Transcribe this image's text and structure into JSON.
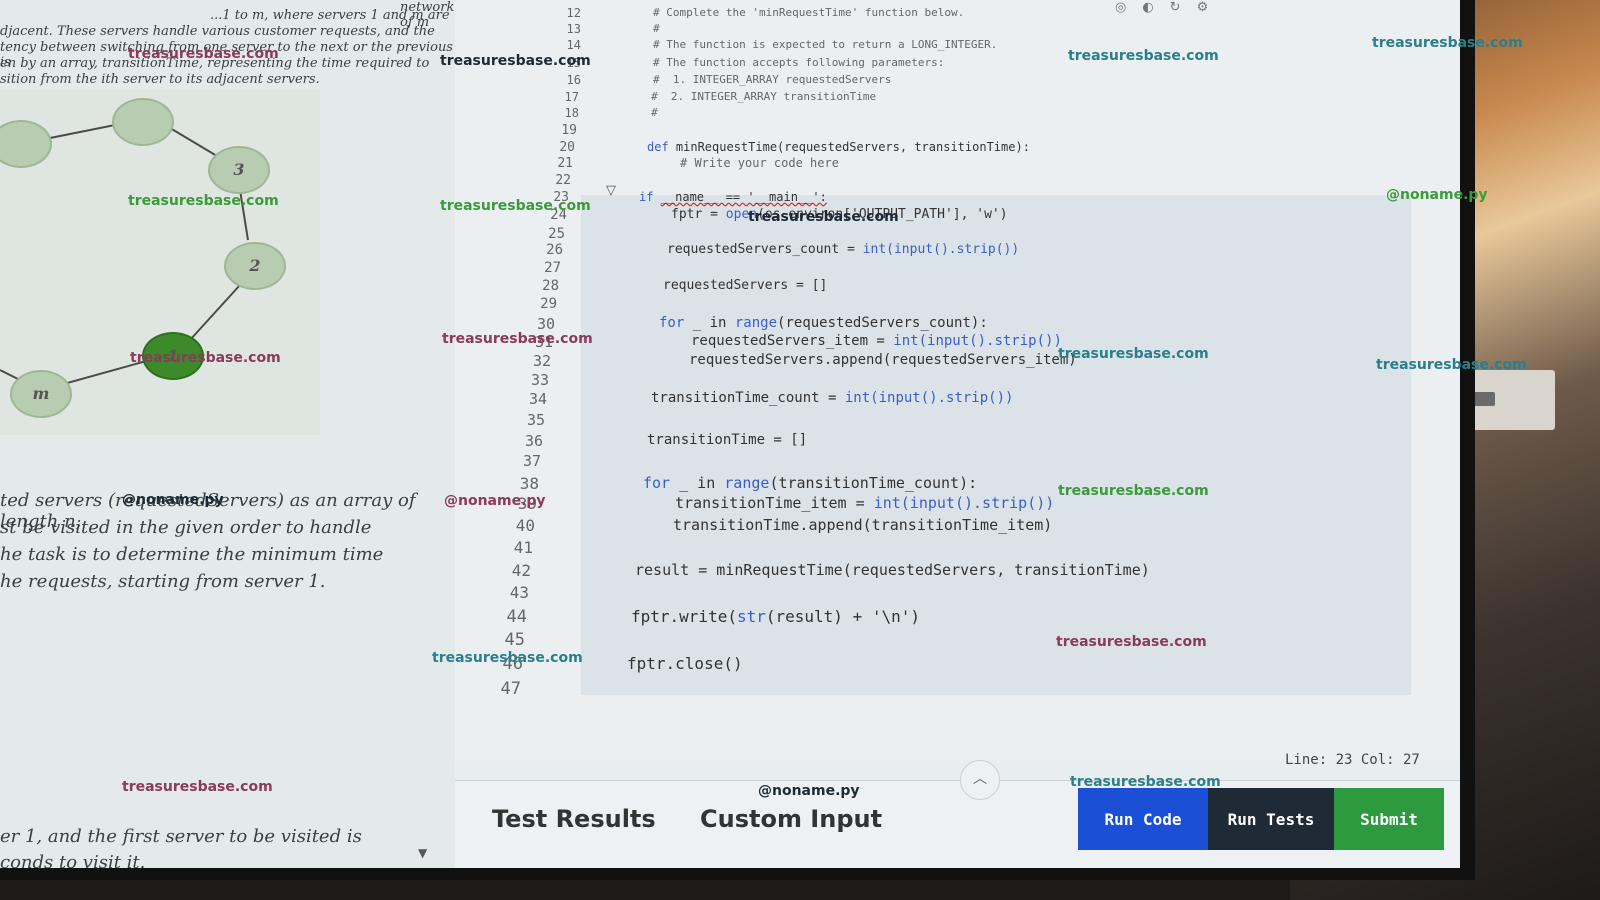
{
  "problem": {
    "top_lines": [
      "network of m",
      "...1 to m, where servers 1 and m are",
      "djacent. These servers handle various customer requests, and the",
      "tency between switching from one server to the next or the previous is",
      "en by an array, transitionTime, representing the time required to",
      "sition from the ith server to its adjacent servers."
    ],
    "mid_lines": [
      "ted servers (requestedServers) as an array of length n,",
      "st be visited in the given order to handle",
      "he task is to determine the minimum time",
      "he requests, starting from server 1."
    ],
    "bottom_lines": [
      "er 1, and the first server to be visited is",
      "conds to visit it."
    ],
    "graph_nodes": [
      "",
      "",
      "3",
      "2",
      "1",
      "m"
    ]
  },
  "editor": {
    "line_numbers": [
      "12",
      "13",
      "14",
      "15",
      "16",
      "17",
      "18",
      "19",
      "20",
      "21",
      "22",
      "23",
      "24",
      "25",
      "26",
      "27",
      "28",
      "29",
      "30",
      "31",
      "32",
      "33",
      "34",
      "35",
      "36",
      "37",
      "38",
      "39",
      "40",
      "41",
      "42",
      "43",
      "44",
      "45",
      "46",
      "47"
    ],
    "lines": {
      "l12": "# Complete the 'minRequestTime' function below.",
      "l13": "#",
      "l14": "# The function is expected to return a LONG_INTEGER.",
      "l15": "# The function accepts following parameters:",
      "l16": "#  1. INTEGER_ARRAY requestedServers",
      "l17": "#  2. INTEGER_ARRAY transitionTime",
      "l18": "#",
      "l20a": "def ",
      "l20b": "minRequestTime(requestedServers, transitionTime):",
      "l21": "# Write your code here",
      "l23a": "if ",
      "l23b": "__name__ == '__main__':",
      "l24a": "fptr = ",
      "l24b": "open",
      "l24c": "(os.environ['OUTPUT_PATH'], 'w')",
      "l26a": "requestedServers_count = ",
      "l26b": "int(input().strip())",
      "l28": "requestedServers = []",
      "l30a": "for",
      "l30b": " _ in ",
      "l30c": "range",
      "l30d": "(requestedServers_count):",
      "l31a": "requestedServers_item = ",
      "l31b": "int(input().strip())",
      "l32": "requestedServers.append(requestedServers_item)",
      "l34a": "transitionTime_count = ",
      "l34b": "int(input().strip())",
      "l36": "transitionTime = []",
      "l38a": "for",
      "l38b": " _ in ",
      "l38c": "range",
      "l38d": "(transitionTime_count):",
      "l39a": "transitionTime_item = ",
      "l39b": "int(input().strip())",
      "l40": "transitionTime.append(transitionTime_item)",
      "l42": "result = minRequestTime(requestedServers, transitionTime)",
      "l44a": "fptr.write(",
      "l44b": "str",
      "l44c": "(result) + '\\n')",
      "l46": "fptr.close()"
    },
    "status": "Line: 23 Col: 27"
  },
  "bottom": {
    "tab_test_results": "Test Results",
    "tab_custom_input": "Custom Input",
    "run_code": "Run Code",
    "run_tests": "Run Tests",
    "submit": "Submit",
    "collapse_icon": "chevron-up-icon"
  },
  "watermarks": {
    "site": "treasuresbase.com",
    "handle": "@noname.py"
  },
  "colors": {
    "run_code_bg": "#1a4fd6",
    "run_tests_bg": "#1f2a37",
    "submit_bg": "#2e9a40"
  }
}
